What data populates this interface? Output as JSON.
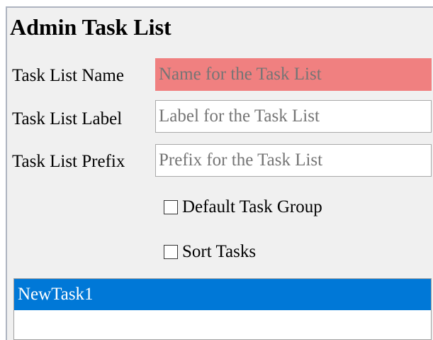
{
  "title": "Admin Task List",
  "fields": {
    "name": {
      "label": "Task List Name",
      "placeholder": "Name for the Task List",
      "value": ""
    },
    "label": {
      "label": "Task List Label",
      "placeholder": "Label for the Task List",
      "value": ""
    },
    "prefix": {
      "label": "Task List Prefix",
      "placeholder": "Prefix for the Task List",
      "value": ""
    }
  },
  "checkboxes": {
    "default_group": {
      "label": "Default Task Group",
      "checked": false
    },
    "sort_tasks": {
      "label": "Sort Tasks",
      "checked": false
    }
  },
  "task_list": {
    "items": [
      {
        "label": "NewTask1",
        "selected": true
      }
    ]
  },
  "colors": {
    "panel_bg": "#f0f0f0",
    "error_field_bg": "#f08080",
    "selection_bg": "#0078d7",
    "selection_text": "#ffffff"
  }
}
